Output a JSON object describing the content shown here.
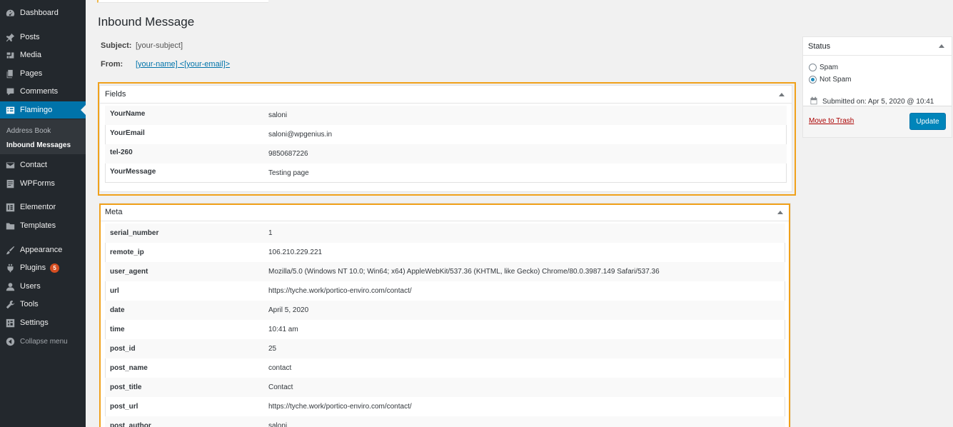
{
  "sidebar": {
    "items": [
      {
        "label": "Dashboard",
        "icon": "dashboard-icon"
      },
      {
        "label": "Posts",
        "icon": "pin-icon"
      },
      {
        "label": "Media",
        "icon": "media-icon"
      },
      {
        "label": "Pages",
        "icon": "pages-icon"
      },
      {
        "label": "Comments",
        "icon": "comment-icon"
      },
      {
        "label": "Flamingo",
        "icon": "flamingo-icon"
      },
      {
        "label": "Contact",
        "icon": "mail-icon"
      },
      {
        "label": "WPForms",
        "icon": "forms-icon"
      },
      {
        "label": "Elementor",
        "icon": "elementor-icon"
      },
      {
        "label": "Templates",
        "icon": "folder-icon"
      },
      {
        "label": "Appearance",
        "icon": "brush-icon"
      },
      {
        "label": "Plugins",
        "icon": "plugin-icon",
        "badge": "5"
      },
      {
        "label": "Users",
        "icon": "user-icon"
      },
      {
        "label": "Tools",
        "icon": "wrench-icon"
      },
      {
        "label": "Settings",
        "icon": "settings-icon"
      }
    ],
    "submenu": [
      "Address Book",
      "Inbound Messages"
    ],
    "collapse_label": "Collapse menu"
  },
  "page": {
    "title": "Inbound Message",
    "subject_label": "Subject:",
    "subject_value": "[your-subject]",
    "from_label": "From:",
    "from_value": "[your-name] <[your-email]>"
  },
  "fields": {
    "title": "Fields",
    "rows": [
      {
        "key": "YourName",
        "value": "saloni"
      },
      {
        "key": "YourEmail",
        "value": "saloni@wpgenius.in"
      },
      {
        "key": "tel-260",
        "value": "9850687226"
      },
      {
        "key": "YourMessage",
        "value": "Testing page"
      }
    ]
  },
  "meta": {
    "title": "Meta",
    "rows": [
      {
        "key": "serial_number",
        "value": "1"
      },
      {
        "key": "remote_ip",
        "value": "106.210.229.221"
      },
      {
        "key": "user_agent",
        "value": "Mozilla/5.0 (Windows NT 10.0; Win64; x64) AppleWebKit/537.36 (KHTML, like Gecko) Chrome/80.0.3987.149 Safari/537.36"
      },
      {
        "key": "url",
        "value": "https://tyche.work/portico-enviro.com/contact/"
      },
      {
        "key": "date",
        "value": "April 5, 2020"
      },
      {
        "key": "time",
        "value": "10:41 am"
      },
      {
        "key": "post_id",
        "value": "25"
      },
      {
        "key": "post_name",
        "value": "contact"
      },
      {
        "key": "post_title",
        "value": "Contact"
      },
      {
        "key": "post_url",
        "value": "https://tyche.work/portico-enviro.com/contact/"
      },
      {
        "key": "post_author",
        "value": "saloni"
      }
    ]
  },
  "status": {
    "title": "Status",
    "spam_label": "Spam",
    "not_spam_label": "Not Spam",
    "selected": "Not Spam",
    "submitted": "Submitted on: Apr 5, 2020 @ 10:41",
    "trash_label": "Move to Trash",
    "update_label": "Update"
  },
  "colors": {
    "sidebar_bg": "#23282d",
    "active_bg": "#0073aa",
    "highlight": "#f0a11b",
    "button": "#0085ba"
  }
}
